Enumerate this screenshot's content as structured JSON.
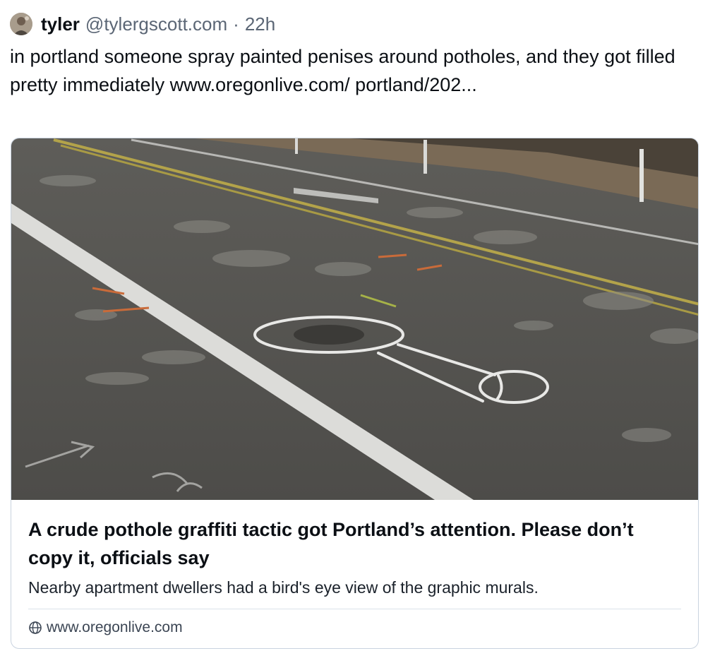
{
  "post": {
    "author": "tyler",
    "handle": "@tylergscott.com",
    "separator": "·",
    "time": "22h",
    "avatar_icon": "avatar-photo",
    "text": "in portland someone spray painted penises around potholes, and they got filled pretty immediately www.oregonlive.com/ portland/202..."
  },
  "link_card": {
    "image_description_icon": "street-photo",
    "title": "A crude pothole graffiti tactic got Portland’s attention. Please don’t copy it, officials say",
    "description": "Nearby apartment dwellers had a bird's eye view of the graphic murals.",
    "domain_icon": "globe-icon",
    "domain": "www.oregonlive.com"
  },
  "colors": {
    "text": "#0b0f14",
    "muted": "#5b6675",
    "border": "#c9d3df"
  }
}
